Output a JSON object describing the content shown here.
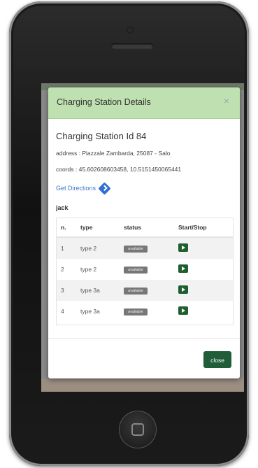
{
  "modal": {
    "title": "Charging Station Details",
    "close_glyph": "×",
    "station_title": "Charging Station Id 84",
    "address": "address : Piazzale Zambarda, 25087 - Salo",
    "coords": "coords : 45.602608603458, 10.5151450065441",
    "directions_label": "Get Directions",
    "jack_label": "jack",
    "table": {
      "headers": [
        "n.",
        "type",
        "status",
        "Start/Stop"
      ],
      "rows": [
        {
          "n": "1",
          "type": "type 2",
          "status": "available"
        },
        {
          "n": "2",
          "type": "type 2",
          "status": "available"
        },
        {
          "n": "3",
          "type": "type 3a",
          "status": "available"
        },
        {
          "n": "4",
          "type": "type 3a",
          "status": "available"
        }
      ]
    },
    "close_button": "close"
  },
  "colors": {
    "header_bg": "#bfe0b0",
    "primary_button": "#1f5e38",
    "link": "#3a78c9",
    "badge": "#777777"
  },
  "icons": {
    "close": "close-icon",
    "directions": "directions-icon",
    "start": "play-icon"
  }
}
